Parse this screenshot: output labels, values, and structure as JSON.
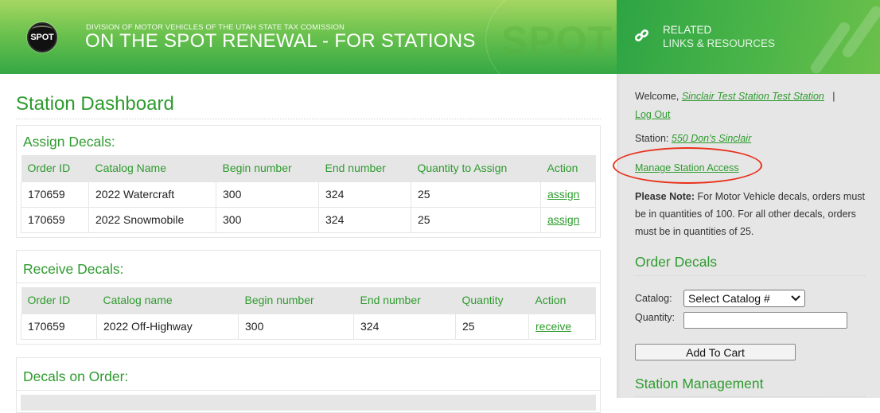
{
  "header": {
    "logo_text": "SPOT",
    "subtitle": "DIVISION OF MOTOR VEHICLES OF THE UTAH STATE TAX COMISSION",
    "title": "ON THE SPOT RENEWAL - FOR STATIONS",
    "watermark": "SPOT",
    "related_line1": "RELATED",
    "related_line2": "LINKS & RESOURCES"
  },
  "main": {
    "page_title": "Station Dashboard",
    "assign": {
      "heading": "Assign Decals:",
      "columns": [
        "Order ID",
        "Catalog Name",
        "Begin number",
        "End number",
        "Quantity to Assign",
        "Action"
      ],
      "rows": [
        {
          "order_id": "170659",
          "catalog": "2022 Watercraft",
          "begin": "300",
          "end": "324",
          "qty": "25",
          "action": "assign"
        },
        {
          "order_id": "170659",
          "catalog": "2022 Snowmobile",
          "begin": "300",
          "end": "324",
          "qty": "25",
          "action": "assign"
        }
      ]
    },
    "receive": {
      "heading": "Receive Decals:",
      "columns": [
        "Order ID",
        "Catalog name",
        "Begin number",
        "End number",
        "Quantity",
        "Action"
      ],
      "rows": [
        {
          "order_id": "170659",
          "catalog": "2022 Off-Highway",
          "begin": "300",
          "end": "324",
          "qty": "25",
          "action": "receive"
        }
      ]
    },
    "on_order": {
      "heading": "Decals on Order:"
    }
  },
  "sidebar": {
    "welcome_prefix": "Welcome, ",
    "user_name": "Sinclair Test Station Test Station",
    "separator": "|",
    "logout": "Log Out",
    "station_prefix": "Station: ",
    "station_name": "550 Don's Sinclair",
    "manage_access": "Manage Station Access",
    "note_bold": "Please Note:",
    "note_text": " For Motor Vehicle decals, orders must be in quantities of 100. For all other decals, orders must be in quantities of 25.",
    "order_heading": "Order Decals",
    "catalog_label": "Catalog:",
    "catalog_selected": "Select Catalog #",
    "quantity_label": "Quantity:",
    "quantity_value": "",
    "add_to_cart": "Add To Cart",
    "station_mgmt_heading": "Station Management"
  },
  "colors": {
    "brand_green": "#2e9b2e",
    "highlight_red": "#e8321c",
    "sidebar_bg": "#e6e6e6"
  }
}
